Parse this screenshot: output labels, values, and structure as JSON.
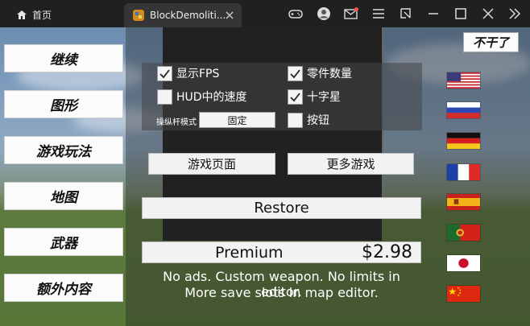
{
  "titlebar": {
    "home_label": "首页",
    "tab_label": "BlockDemoliti...",
    "icons": [
      "gamepad-icon",
      "account-icon",
      "mail-icon",
      "menu-icon",
      "shrink-icon",
      "minimize-icon",
      "maximize-icon",
      "close-icon",
      "expand-icon"
    ],
    "notification_color": "#ff4d3a"
  },
  "menu": {
    "items": [
      {
        "label": "继续"
      },
      {
        "label": "图形"
      },
      {
        "label": "游戏玩法"
      },
      {
        "label": "地图"
      },
      {
        "label": "武器"
      },
      {
        "label": "额外内容"
      }
    ]
  },
  "quit_label": "不干了",
  "settings": {
    "show_fps": {
      "label": "显示FPS",
      "checked": true
    },
    "part_count": {
      "label": "零件数量",
      "checked": true
    },
    "hud_speed": {
      "label": "HUD中的速度",
      "checked": false
    },
    "crosshair": {
      "label": "十字星",
      "checked": true
    },
    "joystick_mode_label": "操纵杆模式",
    "joystick_mode_value": "固定",
    "buttons": {
      "label": "按钮",
      "checked": false
    }
  },
  "actions": {
    "game_page": "游戏页面",
    "more_games": "更多游戏",
    "restore": "Restore"
  },
  "premium": {
    "label": "Premium",
    "price": "$2.98",
    "description_line1": "No ads. Custom weapon. No limits in editor.",
    "description_line2": "More save slots in map editor."
  },
  "flags": [
    "usa-flag",
    "russia-flag",
    "germany-flag",
    "france-flag",
    "spain-flag",
    "portugal-flag",
    "japan-flag",
    "china-flag"
  ]
}
